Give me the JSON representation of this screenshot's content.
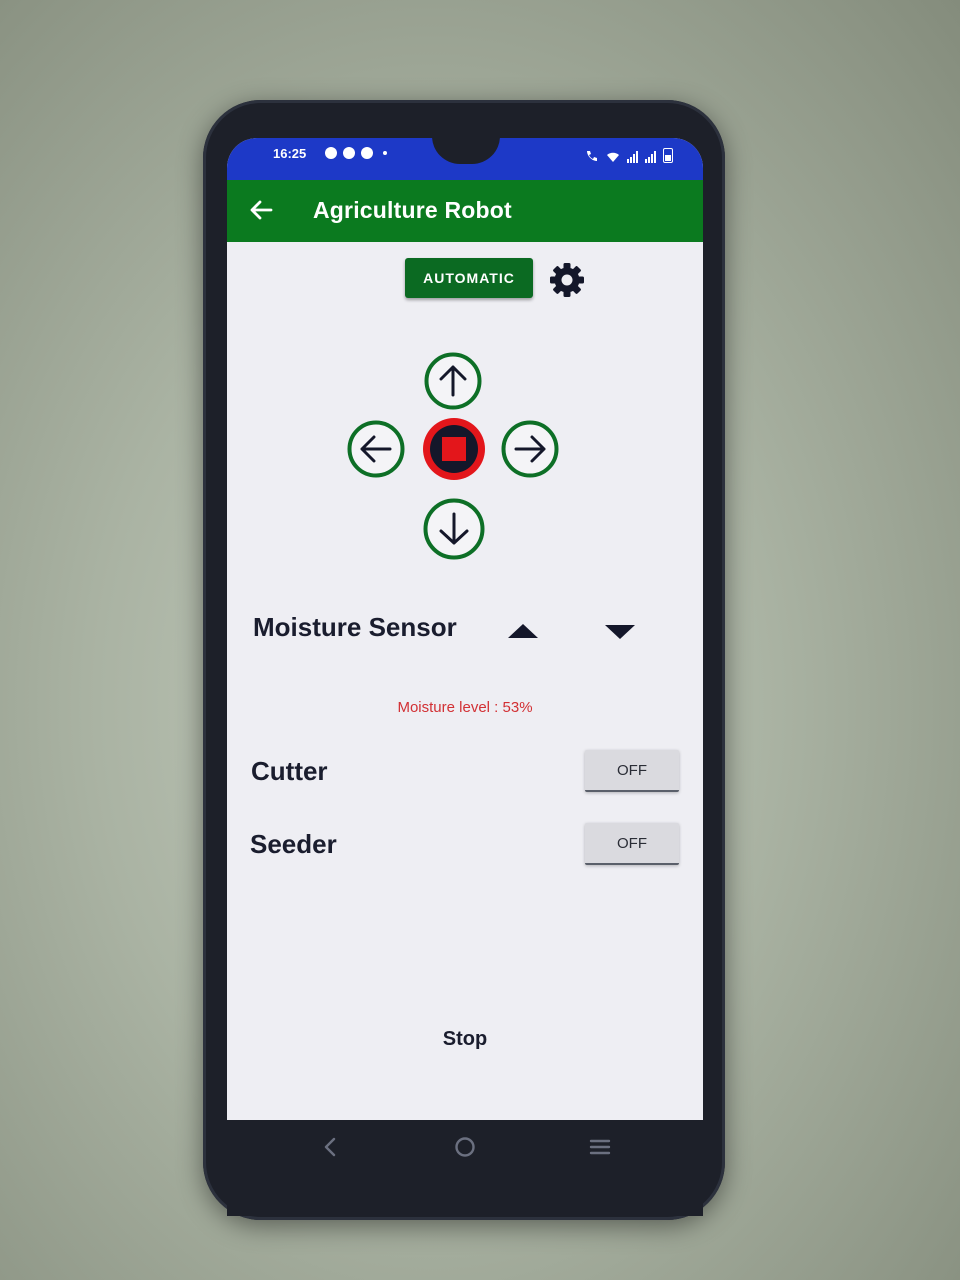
{
  "status_bar": {
    "time": "16:25"
  },
  "app_bar": {
    "title": "Agriculture Robot",
    "back_icon": "arrow-left-icon"
  },
  "controls": {
    "mode_button_label": "AUTOMATIC",
    "settings_icon": "gear-icon",
    "directions": [
      "up-arrow-icon",
      "left-arrow-icon",
      "stop-square-icon",
      "right-arrow-icon",
      "down-arrow-icon"
    ]
  },
  "moisture": {
    "title": "Moisture Sensor",
    "level_text": "Moisture level : 53%",
    "level_percent": 53
  },
  "cutter": {
    "label": "Cutter",
    "state": "OFF"
  },
  "seeder": {
    "label": "Seeder",
    "state": "OFF"
  },
  "stop_label": "Stop",
  "colors": {
    "status_bar": "#1d39c7",
    "app_bar": "#0b7a1f",
    "accent_green": "#0b6a22",
    "stop_red": "#e3161b",
    "moisture_text": "#d23034"
  }
}
